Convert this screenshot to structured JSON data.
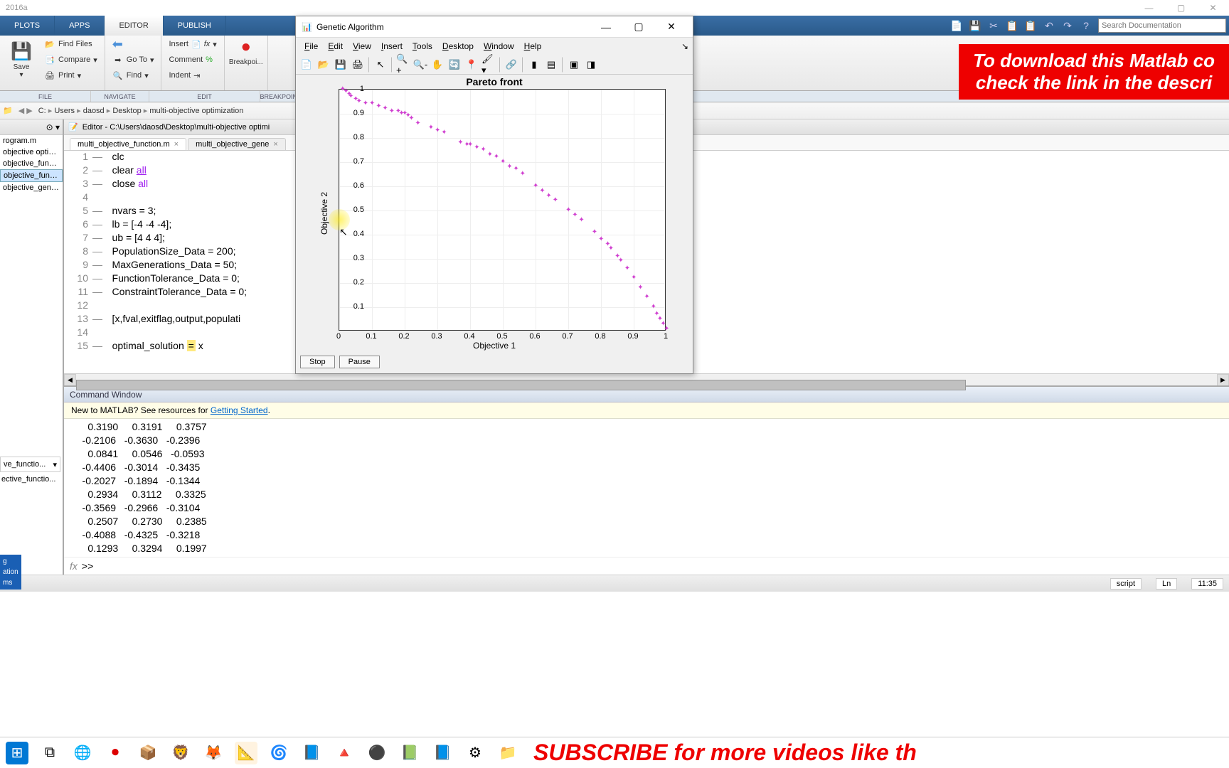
{
  "window": {
    "title": "2016a",
    "min": "—",
    "max": "▢",
    "close": "✕"
  },
  "main_tabs": [
    "PLOTS",
    "APPS",
    "EDITOR",
    "PUBLISH"
  ],
  "main_tab_active": 2,
  "qat": {
    "search_placeholder": "Search Documentation"
  },
  "ribbon": {
    "file": {
      "save": "Save",
      "findfiles": "Find Files",
      "compare": "Compare",
      "print": "Print"
    },
    "nav": {
      "goto": "Go To",
      "find": "Find"
    },
    "edit": {
      "insert": "Insert",
      "comment": "Comment",
      "indent": "Indent"
    },
    "breakpoints": "Breakpoi..."
  },
  "section_labels": [
    "FILE",
    "NAVIGATE",
    "EDIT",
    "BREAKPOIN..."
  ],
  "breadcrumbs": [
    "C:",
    "Users",
    "daosd",
    "Desktop",
    "multi-objective optimization"
  ],
  "folder_items": [
    "rogram.m",
    "objective optimi...",
    "objective_functi...",
    "objective_functi...",
    "objective_geneti..."
  ],
  "folder_selected": 3,
  "editor_title": "Editor - C:\\Users\\daosd\\Desktop\\multi-objective optimi",
  "editor_tabs": [
    {
      "name": "multi_objective_function.m",
      "active": true
    },
    {
      "name": "multi_objective_gene",
      "active": false
    }
  ],
  "code_lines": [
    {
      "n": 1,
      "d": "—",
      "text": "clc"
    },
    {
      "n": 2,
      "d": "—",
      "segs": [
        {
          "t": "clear "
        },
        {
          "t": "all",
          "cls": "kw-str kw-underline"
        }
      ]
    },
    {
      "n": 3,
      "d": "—",
      "segs": [
        {
          "t": "close "
        },
        {
          "t": "all",
          "cls": "kw-str"
        }
      ]
    },
    {
      "n": 4,
      "d": "",
      "text": ""
    },
    {
      "n": 5,
      "d": "—",
      "text": "nvars = 3;"
    },
    {
      "n": 6,
      "d": "—",
      "text": "lb = [-4 -4 -4];"
    },
    {
      "n": 7,
      "d": "—",
      "text": "ub = [4 4 4];"
    },
    {
      "n": 8,
      "d": "—",
      "text": "PopulationSize_Data = 200;"
    },
    {
      "n": 9,
      "d": "—",
      "text": "MaxGenerations_Data = 50;"
    },
    {
      "n": 10,
      "d": "—",
      "text": "FunctionTolerance_Data = 0;"
    },
    {
      "n": 11,
      "d": "—",
      "text": "ConstraintTolerance_Data = 0;"
    },
    {
      "n": 12,
      "d": "",
      "text": ""
    },
    {
      "n": 13,
      "d": "—",
      "text": "[x,fval,exitflag,output,populati                                       ationSize_Data,MaxGenerations_Data,FunctionTolerance"
    },
    {
      "n": 14,
      "d": "",
      "text": ""
    },
    {
      "n": 15,
      "d": "—",
      "segs": [
        {
          "t": "optimal_solution "
        },
        {
          "t": "=",
          "cls": "highlight-cursor"
        },
        {
          "t": " x"
        }
      ]
    }
  ],
  "cmdwin": {
    "title": "Command Window",
    "banner_prefix": "New to MATLAB? See resources for ",
    "banner_link": "Getting Started",
    "rows": [
      [
        0.319,
        0.3191,
        0.3757
      ],
      [
        -0.2106,
        -0.363,
        -0.2396
      ],
      [
        0.0841,
        0.0546,
        -0.0593
      ],
      [
        -0.4406,
        -0.3014,
        -0.3435
      ],
      [
        -0.2027,
        -0.1894,
        -0.1344
      ],
      [
        0.2934,
        0.3112,
        0.3325
      ],
      [
        -0.3569,
        -0.2966,
        -0.3104
      ],
      [
        0.2507,
        0.273,
        0.2385
      ],
      [
        -0.4088,
        -0.4325,
        -0.3218
      ],
      [
        0.1293,
        0.3294,
        0.1997
      ]
    ],
    "prompt": ">>"
  },
  "status": {
    "type": "script",
    "ln": "Ln",
    "col": "11:35"
  },
  "workspace_dd": "ve_functio...",
  "workspace_item": "ective_functio...",
  "leftstrip": [
    "g",
    "ation",
    "ms"
  ],
  "figure": {
    "title": "Genetic Algorithm",
    "menus": [
      "File",
      "Edit",
      "View",
      "Insert",
      "Tools",
      "Desktop",
      "Window",
      "Help"
    ],
    "stop": "Stop",
    "pause": "Pause"
  },
  "chart_data": {
    "type": "scatter",
    "title": "Pareto front",
    "xlabel": "Objective 1",
    "ylabel": "Objective 2",
    "xlim": [
      0,
      1
    ],
    "ylim": [
      0,
      1
    ],
    "xticks": [
      0,
      0.1,
      0.2,
      0.3,
      0.4,
      0.5,
      0.6,
      0.7,
      0.8,
      0.9,
      1
    ],
    "yticks": [
      0.1,
      0.2,
      0.3,
      0.4,
      0.5,
      0.6,
      0.7,
      0.8,
      0.9,
      1
    ],
    "marker": "star",
    "color": "#d040d0",
    "series": [
      {
        "name": "pareto",
        "x": [
          0.01,
          0.02,
          0.03,
          0.035,
          0.05,
          0.06,
          0.08,
          0.1,
          0.12,
          0.14,
          0.16,
          0.18,
          0.19,
          0.2,
          0.21,
          0.22,
          0.24,
          0.28,
          0.3,
          0.32,
          0.37,
          0.39,
          0.4,
          0.42,
          0.44,
          0.46,
          0.48,
          0.5,
          0.52,
          0.54,
          0.56,
          0.6,
          0.62,
          0.64,
          0.66,
          0.7,
          0.72,
          0.74,
          0.78,
          0.8,
          0.82,
          0.83,
          0.85,
          0.86,
          0.88,
          0.9,
          0.92,
          0.94,
          0.96,
          0.97,
          0.98,
          0.99,
          1.0
        ],
        "y": [
          1.0,
          0.99,
          0.98,
          0.97,
          0.96,
          0.95,
          0.94,
          0.94,
          0.93,
          0.92,
          0.91,
          0.91,
          0.9,
          0.9,
          0.89,
          0.88,
          0.86,
          0.84,
          0.83,
          0.82,
          0.78,
          0.77,
          0.77,
          0.76,
          0.75,
          0.73,
          0.72,
          0.7,
          0.68,
          0.67,
          0.65,
          0.6,
          0.58,
          0.56,
          0.54,
          0.5,
          0.48,
          0.46,
          0.41,
          0.38,
          0.36,
          0.34,
          0.31,
          0.29,
          0.26,
          0.22,
          0.18,
          0.14,
          0.1,
          0.07,
          0.05,
          0.03,
          0.01
        ]
      }
    ]
  },
  "overlay": {
    "top1": "To download this Matlab co",
    "top2": "check the link in the descri",
    "bottom": "SUBSCRIBE for more videos like th"
  }
}
